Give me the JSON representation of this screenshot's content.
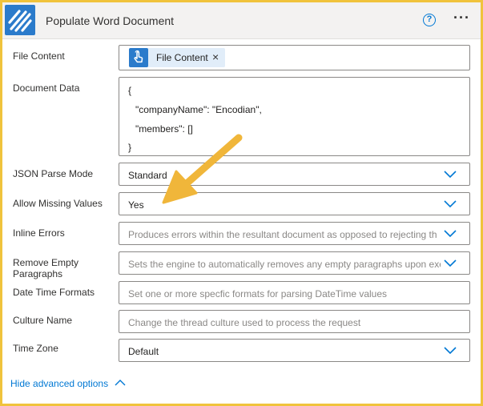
{
  "header": {
    "title": "Populate Word Document"
  },
  "fields": {
    "file_content": {
      "label": "File Content",
      "token": "File Content",
      "token_close": "×"
    },
    "document_data": {
      "label": "Document Data",
      "lines": [
        "{",
        "\"companyName\": \"Encodian\",",
        "\"members\": []",
        "}"
      ]
    },
    "json_parse_mode": {
      "label": "JSON Parse Mode",
      "value": "Standard"
    },
    "allow_missing_values": {
      "label": "Allow Missing Values",
      "value": "Yes"
    },
    "inline_errors": {
      "label": "Inline Errors",
      "placeholder": "Produces errors within the resultant document as opposed to rejecting th"
    },
    "remove_empty_paragraphs": {
      "label_line1": "Remove Empty",
      "label_line2": "Paragraphs",
      "placeholder": "Sets the engine to automatically removes any empty paragraphs upon exe"
    },
    "date_time_formats": {
      "label": "Date Time Formats",
      "placeholder": "Set one or more specfic formats for parsing DateTime values"
    },
    "culture_name": {
      "label": "Culture Name",
      "placeholder": "Change the thread culture used to process the request"
    },
    "time_zone": {
      "label": "Time Zone",
      "value": "Default"
    }
  },
  "footer": {
    "advanced_link": "Hide advanced options"
  },
  "icons": {
    "logo": "encodian-logo-icon",
    "help": "help-icon",
    "more": "more-options-icon",
    "chevron": "chevron-down-icon",
    "chevron_up": "chevron-up-icon",
    "token": "hand-pointer-icon"
  },
  "colors": {
    "accent": "#0078d4",
    "card_border": "#f0c33c",
    "annotation_arrow": "#f0b63a",
    "logo_bg": "#2b7bcb"
  },
  "help_glyph": "?",
  "more_glyph": "···"
}
